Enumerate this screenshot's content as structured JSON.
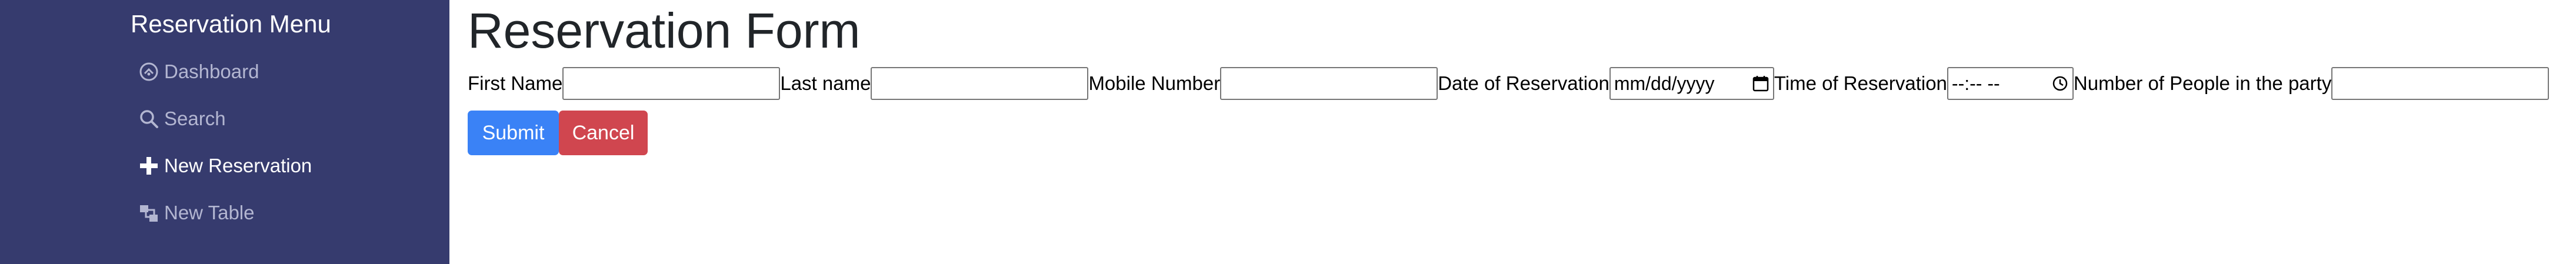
{
  "sidebar": {
    "title": "Reservation Menu",
    "items": [
      {
        "label": "Dashboard",
        "icon": "dashboard-icon"
      },
      {
        "label": "Search",
        "icon": "search-icon"
      },
      {
        "label": "New Reservation",
        "icon": "plus-icon"
      },
      {
        "label": "New Table",
        "icon": "table-icon"
      }
    ]
  },
  "form": {
    "title": "Reservation Form",
    "fields": [
      {
        "label": "First Name",
        "value": ""
      },
      {
        "label": "Last name",
        "value": ""
      },
      {
        "label": "Mobile Number",
        "value": ""
      },
      {
        "label": "Date of Reservation",
        "placeholder": "mm/dd/yyyy"
      },
      {
        "label": "Time of Reservation",
        "placeholder": "--:-- --"
      },
      {
        "label": "Number of People in the party",
        "value": ""
      }
    ],
    "submit_label": "Submit",
    "cancel_label": "Cancel"
  },
  "colors": {
    "sidebar_bg": "#363b6e",
    "submit": "#3a82f6",
    "cancel": "#d0464f"
  }
}
